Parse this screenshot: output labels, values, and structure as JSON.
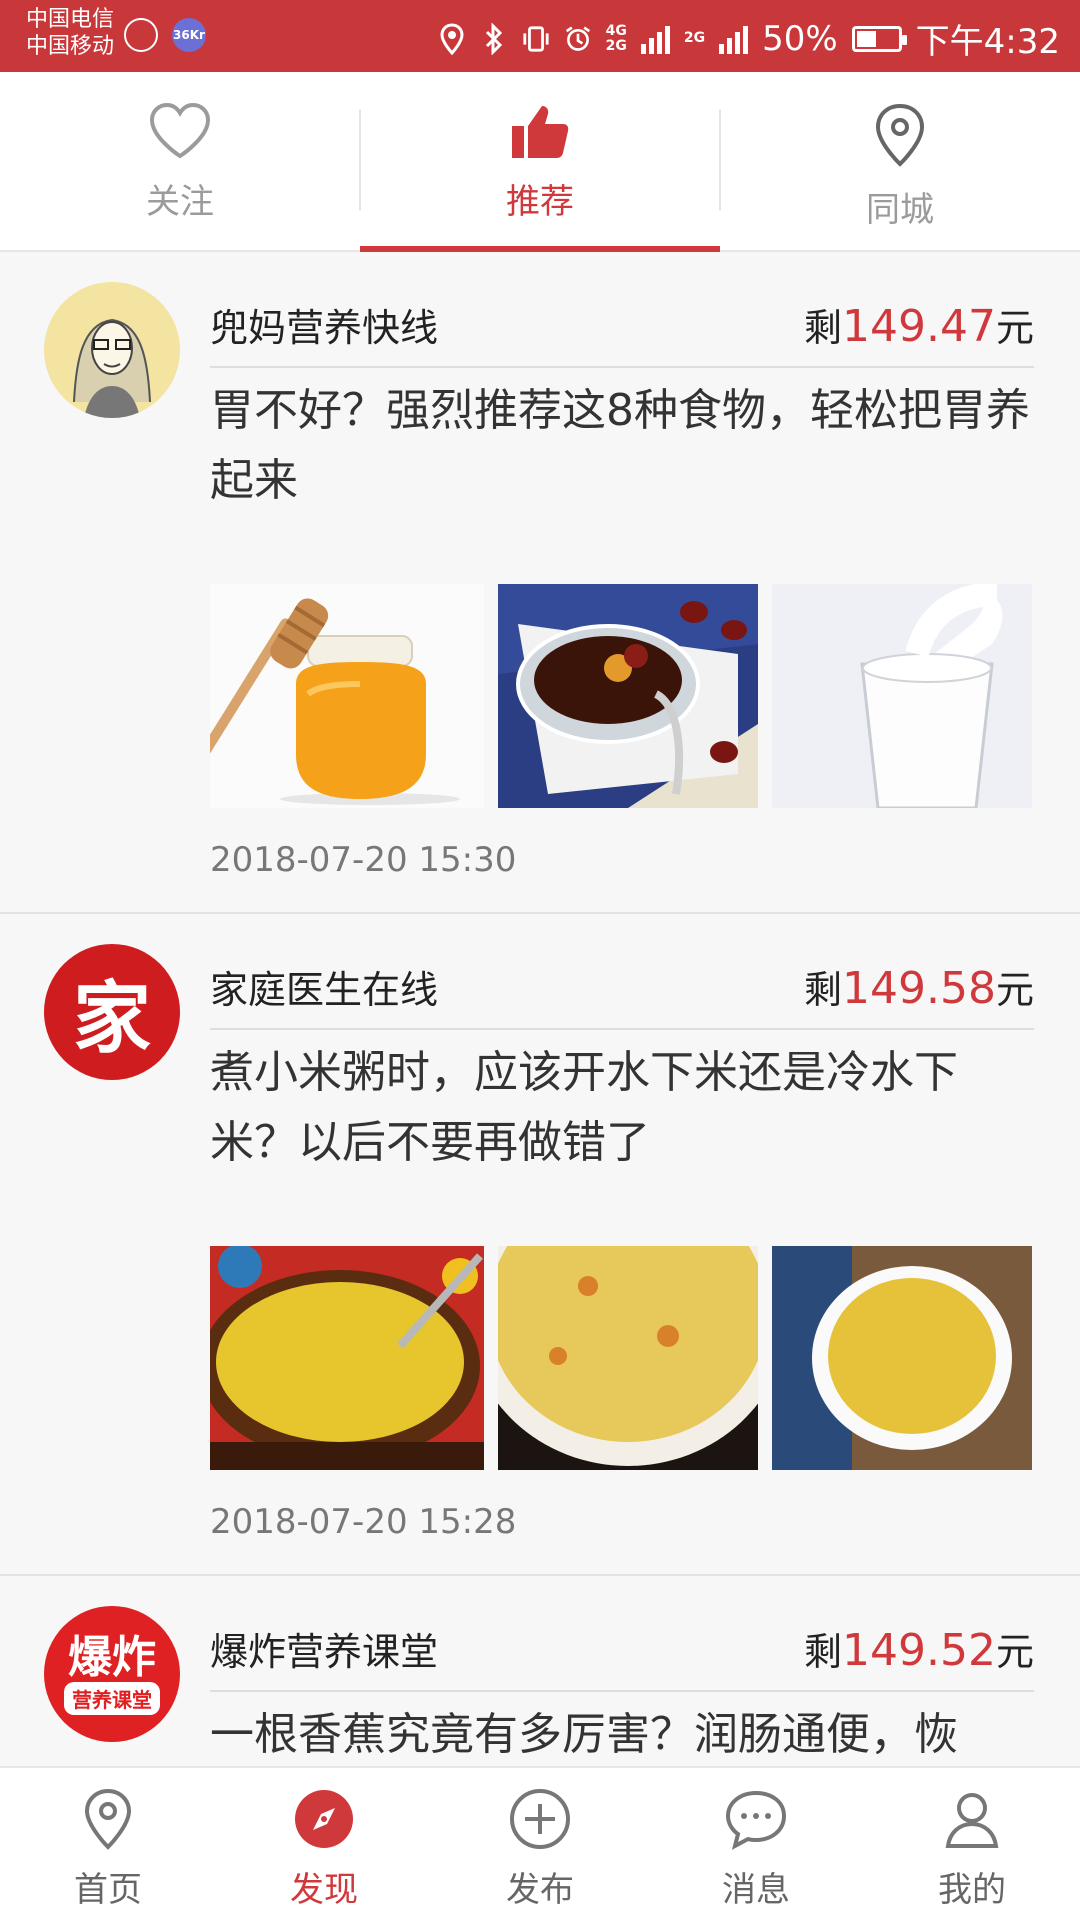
{
  "status_bar": {
    "carrier_1": "中国电信",
    "carrier_2": "中国移动",
    "network_1": "4G",
    "network_2": "2G",
    "network_3": "2G",
    "battery": "50%",
    "time": "下午4:32",
    "badge": "36Kr",
    "accent": "#c8373a"
  },
  "top_tabs": [
    {
      "label": "关注",
      "icon": "heart-icon",
      "active": false
    },
    {
      "label": "推荐",
      "icon": "thumbs-up-icon",
      "active": true
    },
    {
      "label": "同城",
      "icon": "location-pin-icon",
      "active": false
    }
  ],
  "feed": [
    {
      "author": "兜妈营养快线",
      "remain_prefix": "剩",
      "amount": "149.47",
      "unit": "元",
      "title": "胃不好？强烈推荐这8种食物，轻松把胃养起来",
      "thumbs": [
        "honey-jar",
        "date-tea",
        "milk-glass"
      ],
      "date": "2018-07-20 15:30"
    },
    {
      "author": "家庭医生在线",
      "remain_prefix": "剩",
      "amount": "149.58",
      "unit": "元",
      "title": "煮小米粥时，应该开水下米还是冷水下米？以后不要再做错了",
      "thumbs": [
        "millet-porridge-bowl",
        "millet-porridge-closeup",
        "raw-millet-bowl"
      ],
      "date": "2018-07-20 15:28",
      "avatar_text": "家"
    },
    {
      "author": "爆炸营养课堂",
      "remain_prefix": "剩",
      "amount": "149.52",
      "unit": "元",
      "title": "一根香蕉究竟有多厉害？润肠通便，恢",
      "avatar_text_1": "爆炸",
      "avatar_text_2": "营养课堂"
    }
  ],
  "bottom_nav": [
    {
      "label": "首页",
      "icon": "location-pin-icon",
      "active": false
    },
    {
      "label": "发现",
      "icon": "compass-icon",
      "active": true
    },
    {
      "label": "发布",
      "icon": "plus-circle-icon",
      "active": false
    },
    {
      "label": "消息",
      "icon": "chat-bubble-icon",
      "active": false
    },
    {
      "label": "我的",
      "icon": "user-icon",
      "active": false
    }
  ],
  "colors": {
    "accent": "#d0393c",
    "inactive": "#9b9b9b"
  }
}
